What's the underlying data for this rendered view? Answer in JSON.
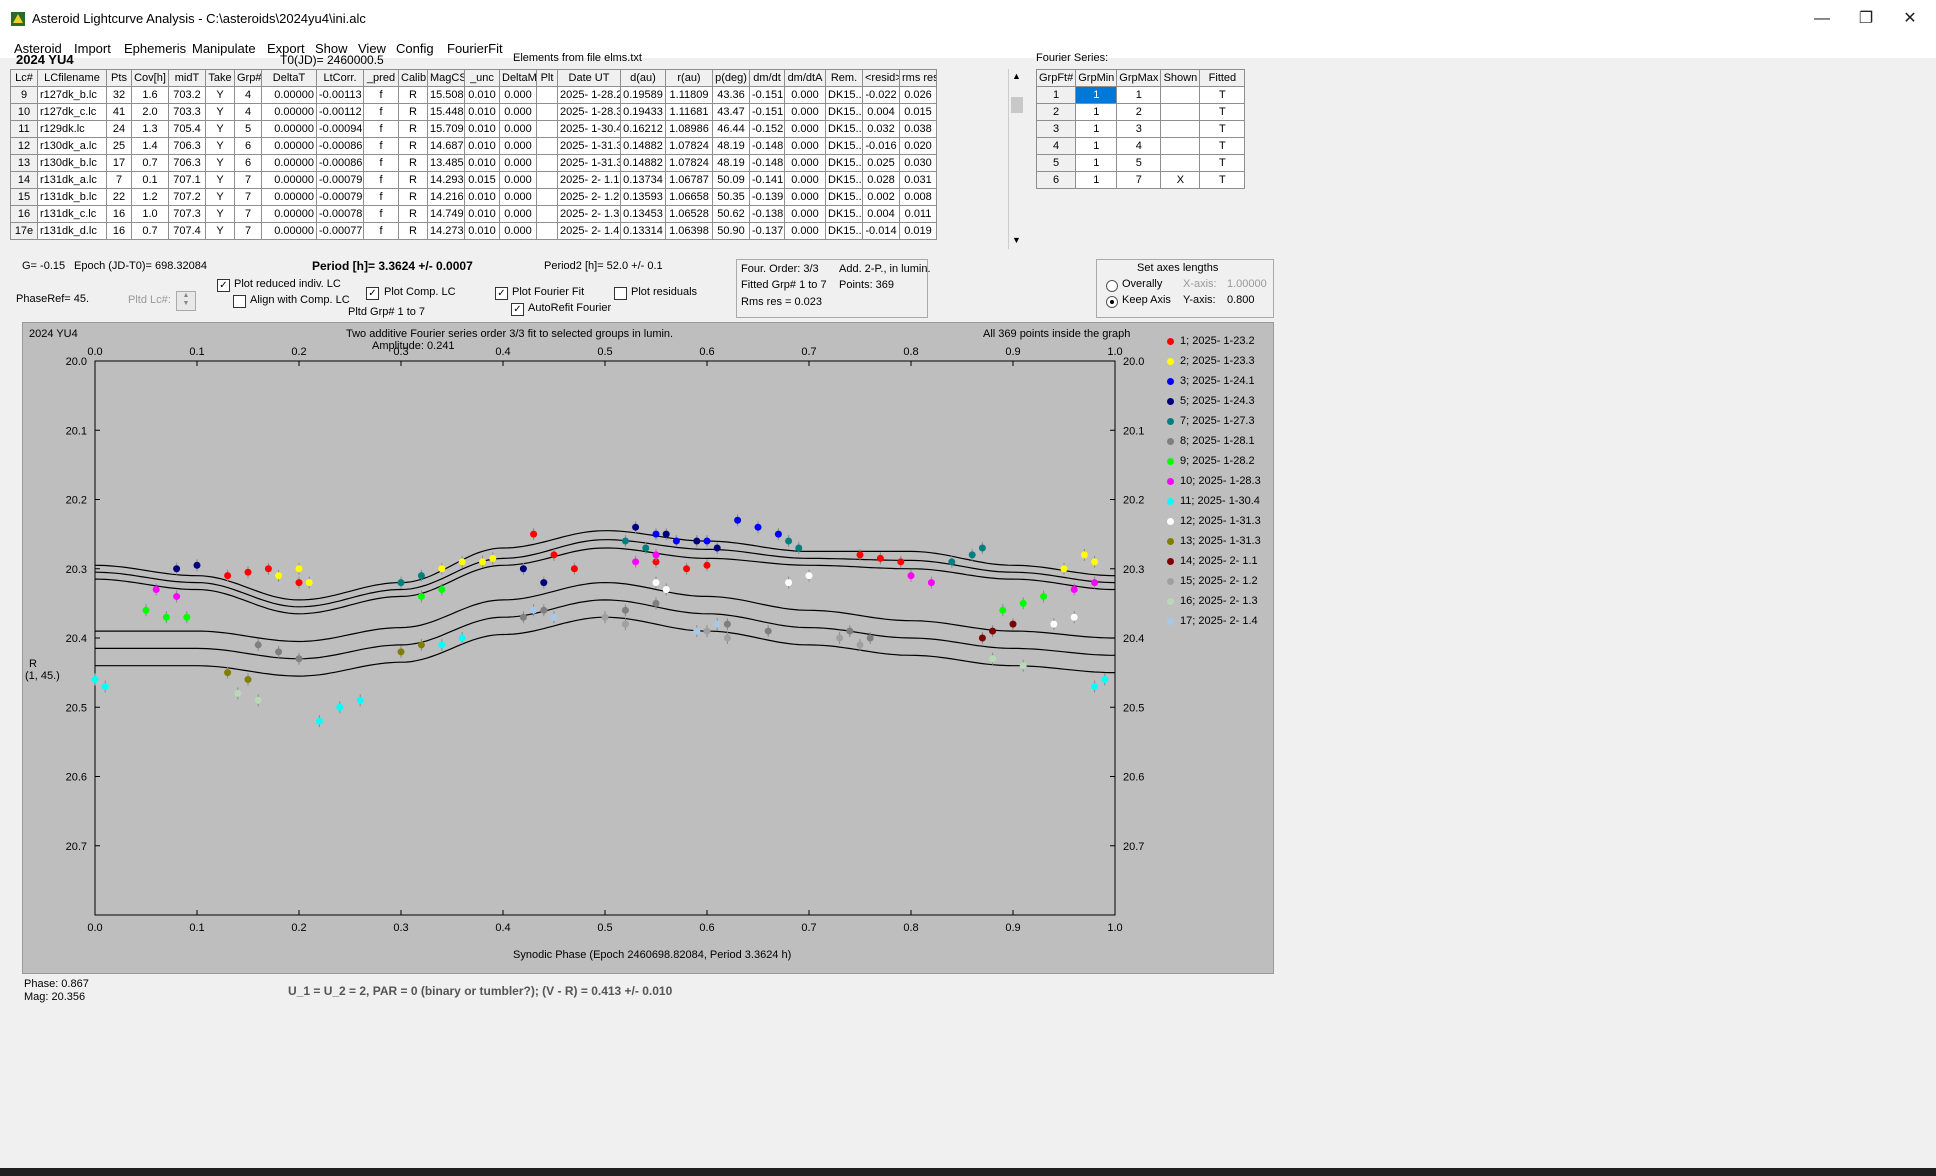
{
  "window": {
    "title": "Asteroid Lightcurve Analysis - C:\\asteroids\\2024yu4\\ini.alc"
  },
  "menu": [
    "Asteroid",
    "Import",
    "Ephemeris",
    "Manipulate",
    "Export",
    "Show",
    "View",
    "Config",
    "FourierFit"
  ],
  "header": {
    "object": "2024 YU4",
    "t0": "T0(JD)= 2460000.5",
    "elements": "Elements from file elms.txt"
  },
  "lc_table": {
    "columns": [
      "Lc#",
      "LCfilename",
      "Pts",
      "Cov[h]",
      "midT",
      "Take",
      "Grp#",
      "DeltaT",
      "LtCorr.",
      "_pred",
      "Calib",
      "MagCS",
      "_unc",
      "DeltaM",
      "Plt",
      "Date UT",
      "d(au)",
      "r(au)",
      "p(deg)",
      "dm/dt",
      "dm/dtA",
      "Rem.",
      "<resid>",
      "rms res"
    ],
    "rows": [
      [
        "9",
        "r127dk_b.lc",
        "32",
        "1.6",
        "703.2",
        "Y",
        "4",
        "0.00000",
        "-0.00113",
        "f",
        "R",
        "15.508",
        "0.010",
        "0.000",
        "",
        "2025- 1-28.2",
        "0.19589",
        "1.11809",
        "43.36",
        "-0.151",
        "0.000",
        "DK15..",
        "-0.022",
        "0.026"
      ],
      [
        "10",
        "r127dk_c.lc",
        "41",
        "2.0",
        "703.3",
        "Y",
        "4",
        "0.00000",
        "-0.00112",
        "f",
        "R",
        "15.448",
        "0.010",
        "0.000",
        "",
        "2025- 1-28.3",
        "0.19433",
        "1.11681",
        "43.47",
        "-0.151",
        "0.000",
        "DK15..",
        "0.004",
        "0.015"
      ],
      [
        "11",
        "r129dk.lc",
        "24",
        "1.3",
        "705.4",
        "Y",
        "5",
        "0.00000",
        "-0.00094",
        "f",
        "R",
        "15.709",
        "0.010",
        "0.000",
        "",
        "2025- 1-30.4",
        "0.16212",
        "1.08986",
        "46.44",
        "-0.152",
        "0.000",
        "DK15..",
        "0.032",
        "0.038"
      ],
      [
        "12",
        "r130dk_a.lc",
        "25",
        "1.4",
        "706.3",
        "Y",
        "6",
        "0.00000",
        "-0.00086",
        "f",
        "R",
        "14.687",
        "0.010",
        "0.000",
        "",
        "2025- 1-31.3",
        "0.14882",
        "1.07824",
        "48.19",
        "-0.148",
        "0.000",
        "DK15..",
        "-0.016",
        "0.020"
      ],
      [
        "13",
        "r130dk_b.lc",
        "17",
        "0.7",
        "706.3",
        "Y",
        "6",
        "0.00000",
        "-0.00086",
        "f",
        "R",
        "13.485",
        "0.010",
        "0.000",
        "",
        "2025- 1-31.3",
        "0.14882",
        "1.07824",
        "48.19",
        "-0.148",
        "0.000",
        "DK15..",
        "0.025",
        "0.030"
      ],
      [
        "14",
        "r131dk_a.lc",
        "7",
        "0.1",
        "707.1",
        "Y",
        "7",
        "0.00000",
        "-0.00079",
        "f",
        "R",
        "14.293",
        "0.015",
        "0.000",
        "",
        "2025- 2- 1.1",
        "0.13734",
        "1.06787",
        "50.09",
        "-0.141",
        "0.000",
        "DK15..",
        "0.028",
        "0.031"
      ],
      [
        "15",
        "r131dk_b.lc",
        "22",
        "1.2",
        "707.2",
        "Y",
        "7",
        "0.00000",
        "-0.00079",
        "f",
        "R",
        "14.216",
        "0.010",
        "0.000",
        "",
        "2025- 2- 1.2",
        "0.13593",
        "1.06658",
        "50.35",
        "-0.139",
        "0.000",
        "DK15..",
        "0.002",
        "0.008"
      ],
      [
        "16",
        "r131dk_c.lc",
        "16",
        "1.0",
        "707.3",
        "Y",
        "7",
        "0.00000",
        "-0.00078",
        "f",
        "R",
        "14.749",
        "0.010",
        "0.000",
        "",
        "2025- 2- 1.3",
        "0.13453",
        "1.06528",
        "50.62",
        "-0.138",
        "0.000",
        "DK15..",
        "0.004",
        "0.011"
      ],
      [
        "17e",
        "r131dk_d.lc",
        "16",
        "0.7",
        "707.4",
        "Y",
        "7",
        "0.00000",
        "-0.00077",
        "f",
        "R",
        "14.273",
        "0.010",
        "0.000",
        "",
        "2025- 2- 1.4",
        "0.13314",
        "1.06398",
        "50.90",
        "-0.137",
        "0.000",
        "DK15..",
        "-0.014",
        "0.019"
      ]
    ]
  },
  "fourier_table": {
    "title": "Fourier Series:",
    "columns": [
      "GrpFt#",
      "GrpMin",
      "GrpMax",
      "Shown",
      "Fitted"
    ],
    "rows": [
      [
        "1",
        "1",
        "1",
        "",
        "T"
      ],
      [
        "2",
        "1",
        "2",
        "",
        "T"
      ],
      [
        "3",
        "1",
        "3",
        "",
        "T"
      ],
      [
        "4",
        "1",
        "4",
        "",
        "T"
      ],
      [
        "5",
        "1",
        "5",
        "",
        "T"
      ],
      [
        "6",
        "1",
        "7",
        "X",
        "T"
      ]
    ]
  },
  "params": {
    "g": "G= -0.15",
    "epoch": "Epoch (JD-T0)= 698.32084",
    "period": "Period [h]= 3.3624 +/- 0.0007",
    "period2": "Period2 [h]= 52.0 +/- 0.1",
    "phaseref": "PhaseRef= 45.",
    "pltd_lc": "Pltd Lc#:"
  },
  "options": {
    "plot_reduced": "Plot reduced indiv. LC",
    "align_comp": "Align with Comp. LC",
    "plot_comp": "Plot Comp. LC",
    "pltd_grp": "Pltd Grp#  1   to   7",
    "plot_fourier": "Plot Fourier Fit",
    "autorefit": "AutoRefit Fourier",
    "plot_resid": "Plot residuals"
  },
  "fit_info": {
    "order": "Four. Order:  3/3",
    "add": "Add. 2-P., in lumin.",
    "fitted": "Fitted Grp# 1 to 7",
    "points": "Points: 369",
    "rms": "Rms res      = 0.023"
  },
  "axes_box": {
    "title": "Set axes lengths",
    "overally": "Overally",
    "keep": "Keep Axis",
    "xaxis": "X-axis:",
    "xval": "1.00000",
    "yaxis": "Y-axis:",
    "yval": "0.800"
  },
  "chart_labels": {
    "obj": "2024 YU4",
    "title": "Two additive Fourier series order 3/3 fit to selected groups in lumin.",
    "amp": "Amplitude: 0.241",
    "inside": "All 369 points inside the graph",
    "ylab1": "R",
    "ylab2": "(1, 45.)",
    "xlab": "Synodic Phase (Epoch 2460698.82084, Period 3.3624 h)"
  },
  "chart_data": {
    "type": "scatter",
    "xlim": [
      0,
      1
    ],
    "ylim": [
      20.8,
      20.0
    ],
    "x_ticks": [
      "0.0",
      "0.1",
      "0.2",
      "0.3",
      "0.4",
      "0.5",
      "0.6",
      "0.7",
      "0.8",
      "0.9",
      "1.0"
    ],
    "y_ticks": [
      "20.0",
      "20.1",
      "20.2",
      "20.3",
      "20.4",
      "20.5",
      "20.6",
      "20.7"
    ],
    "legend": [
      {
        "label": "1; 2025- 1-23.2",
        "color": "#ff0000"
      },
      {
        "label": "2; 2025- 1-23.3",
        "color": "#ffff00"
      },
      {
        "label": "3; 2025- 1-24.1",
        "color": "#0000ff"
      },
      {
        "label": "5; 2025- 1-24.3",
        "color": "#00007f"
      },
      {
        "label": "7; 2025- 1-27.3",
        "color": "#007f7f"
      },
      {
        "label": "8; 2025- 1-28.1",
        "color": "#7f7f7f"
      },
      {
        "label": "9; 2025- 1-28.2",
        "color": "#00ff00"
      },
      {
        "label": "10; 2025- 1-28.3",
        "color": "#ff00ff"
      },
      {
        "label": "11; 2025- 1-30.4",
        "color": "#00ffff"
      },
      {
        "label": "12; 2025- 1-31.3",
        "color": "#ffffff"
      },
      {
        "label": "13; 2025- 1-31.3",
        "color": "#7f7f00"
      },
      {
        "label": "14; 2025- 2- 1.1",
        "color": "#7f0000"
      },
      {
        "label": "15; 2025- 2- 1.2",
        "color": "#a0a0a0"
      },
      {
        "label": "16; 2025- 2- 1.3",
        "color": "#b8d8b8"
      },
      {
        "label": "17; 2025- 2- 1.4",
        "color": "#a8c8e8"
      }
    ],
    "curves": [
      {
        "x": [
          0,
          0.1,
          0.2,
          0.3,
          0.4,
          0.5,
          0.6,
          0.7,
          0.8,
          0.9,
          1.0
        ],
        "y": [
          20.295,
          20.31,
          20.345,
          20.32,
          20.27,
          20.245,
          20.26,
          20.275,
          20.275,
          20.295,
          20.31
        ]
      },
      {
        "x": [
          0,
          0.1,
          0.2,
          0.3,
          0.4,
          0.5,
          0.6,
          0.7,
          0.8,
          0.9,
          1.0
        ],
        "y": [
          20.305,
          20.32,
          20.355,
          20.33,
          20.285,
          20.258,
          20.272,
          20.285,
          20.288,
          20.305,
          20.32
        ]
      },
      {
        "x": [
          0,
          0.1,
          0.2,
          0.3,
          0.4,
          0.5,
          0.6,
          0.7,
          0.8,
          0.9,
          1.0
        ],
        "y": [
          20.315,
          20.33,
          20.365,
          20.34,
          20.295,
          20.27,
          20.285,
          20.295,
          20.3,
          20.315,
          20.33
        ]
      },
      {
        "x": [
          0,
          0.1,
          0.2,
          0.3,
          0.4,
          0.5,
          0.6,
          0.7,
          0.8,
          0.9,
          1.0
        ],
        "y": [
          20.39,
          20.39,
          20.405,
          20.385,
          20.345,
          20.32,
          20.34,
          20.36,
          20.375,
          20.39,
          20.4
        ]
      },
      {
        "x": [
          0,
          0.1,
          0.2,
          0.3,
          0.4,
          0.5,
          0.6,
          0.7,
          0.8,
          0.9,
          1.0
        ],
        "y": [
          20.415,
          20.415,
          20.43,
          20.41,
          20.37,
          20.345,
          20.365,
          20.385,
          20.4,
          20.415,
          20.425
        ]
      },
      {
        "x": [
          0,
          0.1,
          0.2,
          0.3,
          0.4,
          0.5,
          0.6,
          0.7,
          0.8,
          0.9,
          1.0
        ],
        "y": [
          20.44,
          20.44,
          20.455,
          20.435,
          20.395,
          20.37,
          20.39,
          20.41,
          20.425,
          20.44,
          20.45
        ]
      }
    ],
    "points": [
      {
        "g": 0,
        "x": [
          0.13,
          0.15,
          0.17,
          0.2,
          0.43,
          0.45,
          0.47,
          0.55,
          0.58,
          0.6,
          0.75,
          0.77,
          0.79
        ],
        "y": [
          20.31,
          20.305,
          20.3,
          20.32,
          20.25,
          20.28,
          20.3,
          20.29,
          20.3,
          20.295,
          20.28,
          20.285,
          20.29
        ]
      },
      {
        "g": 1,
        "x": [
          0.18,
          0.2,
          0.21,
          0.34,
          0.36,
          0.38,
          0.39,
          0.95,
          0.97,
          0.98
        ],
        "y": [
          20.31,
          20.3,
          20.32,
          20.3,
          20.29,
          20.29,
          20.285,
          20.3,
          20.28,
          20.29
        ]
      },
      {
        "g": 2,
        "x": [
          0.55,
          0.57,
          0.6,
          0.63,
          0.65,
          0.67
        ],
        "y": [
          20.25,
          20.26,
          20.26,
          20.23,
          20.24,
          20.25
        ]
      },
      {
        "g": 3,
        "x": [
          0.08,
          0.1,
          0.42,
          0.44,
          0.53,
          0.56,
          0.59,
          0.61
        ],
        "y": [
          20.3,
          20.295,
          20.3,
          20.32,
          20.24,
          20.25,
          20.26,
          20.27
        ]
      },
      {
        "g": 4,
        "x": [
          0.3,
          0.32,
          0.52,
          0.54,
          0.68,
          0.69,
          0.84,
          0.86,
          0.87
        ],
        "y": [
          20.32,
          20.31,
          20.26,
          20.27,
          20.26,
          20.27,
          20.29,
          20.28,
          20.27
        ]
      },
      {
        "g": 5,
        "x": [
          0.16,
          0.18,
          0.2,
          0.42,
          0.44,
          0.52,
          0.55,
          0.62,
          0.66,
          0.74,
          0.76
        ],
        "y": [
          20.41,
          20.42,
          20.43,
          20.37,
          20.36,
          20.36,
          20.35,
          20.38,
          20.39,
          20.39,
          20.4
        ]
      },
      {
        "g": 6,
        "x": [
          0.05,
          0.07,
          0.09,
          0.32,
          0.34,
          0.89,
          0.91,
          0.93
        ],
        "y": [
          20.36,
          20.37,
          20.37,
          20.34,
          20.33,
          20.36,
          20.35,
          20.34
        ]
      },
      {
        "g": 7,
        "x": [
          0.06,
          0.08,
          0.53,
          0.55,
          0.8,
          0.82,
          0.96,
          0.98
        ],
        "y": [
          20.33,
          20.34,
          20.29,
          20.28,
          20.31,
          20.32,
          20.33,
          20.32
        ]
      },
      {
        "g": 8,
        "x": [
          0.0,
          0.01,
          0.22,
          0.24,
          0.26,
          0.34,
          0.36,
          0.98,
          0.99
        ],
        "y": [
          20.46,
          20.47,
          20.52,
          20.5,
          20.49,
          20.41,
          20.4,
          20.47,
          20.46
        ]
      },
      {
        "g": 9,
        "x": [
          0.55,
          0.56,
          0.68,
          0.7,
          0.94,
          0.96
        ],
        "y": [
          20.32,
          20.33,
          20.32,
          20.31,
          20.38,
          20.37
        ]
      },
      {
        "g": 10,
        "x": [
          0.13,
          0.15,
          0.3,
          0.32
        ],
        "y": [
          20.45,
          20.46,
          20.42,
          20.41
        ]
      },
      {
        "g": 11,
        "x": [
          0.87,
          0.88,
          0.9
        ],
        "y": [
          20.4,
          20.39,
          20.38
        ]
      },
      {
        "g": 12,
        "x": [
          0.5,
          0.52,
          0.6,
          0.62,
          0.73,
          0.75
        ],
        "y": [
          20.37,
          20.38,
          20.39,
          20.4,
          20.4,
          20.41
        ]
      },
      {
        "g": 13,
        "x": [
          0.14,
          0.16,
          0.88,
          0.91
        ],
        "y": [
          20.48,
          20.49,
          20.43,
          20.44
        ]
      },
      {
        "g": 14,
        "x": [
          0.43,
          0.45,
          0.59,
          0.61
        ],
        "y": [
          20.36,
          20.37,
          20.39,
          20.38
        ]
      }
    ]
  },
  "readout": {
    "phase": "Phase:  0.867",
    "mag": "Mag:    20.356"
  },
  "bottom_note": "U_1 = U_2 = 2, PAR = 0 (binary or tumbler?); (V - R) = 0.413 +/- 0.010"
}
